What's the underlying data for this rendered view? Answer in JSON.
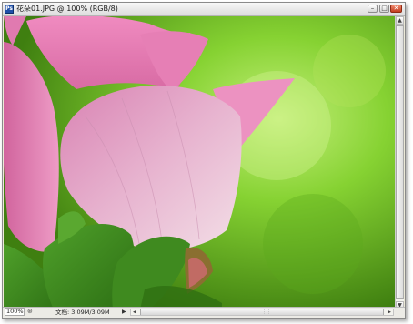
{
  "window": {
    "title": "花朵01.JPG @ 100% (RGB/8)",
    "app_icon_label": "Ps",
    "buttons": {
      "minimize": "–",
      "maximize": "□",
      "close": "✕"
    }
  },
  "status_bar": {
    "zoom": "100%",
    "doc_info": "文档: 3.09M/3.09M",
    "menu_arrow": "▶"
  },
  "scrollbars": {
    "up": "▲",
    "down": "▼",
    "left": "◀",
    "right": "▶",
    "grip": "⋮⋮"
  },
  "colors": {
    "background": "#7fcc2a",
    "petal": "#e68ab8",
    "leaf": "#3f8a1f"
  }
}
